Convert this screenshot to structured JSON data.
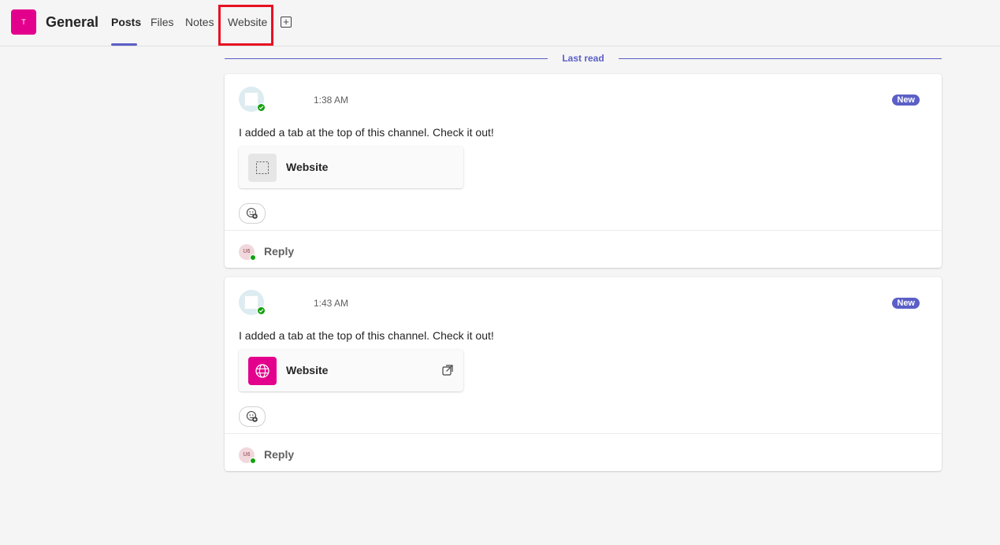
{
  "header": {
    "team_avatar_letter": "T",
    "channel_title": "General",
    "tabs": [
      {
        "label": "Posts",
        "active": true
      },
      {
        "label": "Files",
        "active": false
      },
      {
        "label": "Notes",
        "active": false
      },
      {
        "label": "Website",
        "active": false,
        "highlighted": true
      }
    ],
    "add_tab_icon": "plus-box-icon"
  },
  "divider": {
    "label": "Last read"
  },
  "posts": [
    {
      "time": "1:38 AM",
      "badge": "New",
      "message": "I added a tab at the top of this channel. Check it out!",
      "card": {
        "title": "Website",
        "icon": "placeholder-tab-icon"
      },
      "reply": {
        "avatar_initials": "U6",
        "label": "Reply"
      }
    },
    {
      "time": "1:43 AM",
      "badge": "New",
      "message": "I added a tab at the top of this channel. Check it out!",
      "card": {
        "title": "Website",
        "icon": "globe-icon",
        "open_icon": "open-external-icon"
      },
      "reply": {
        "avatar_initials": "U6",
        "label": "Reply"
      }
    }
  ],
  "colors": {
    "accent": "#5b5fc7",
    "team_avatar": "#e3008c",
    "highlight": "#e81123",
    "presence": "#13a10e"
  }
}
